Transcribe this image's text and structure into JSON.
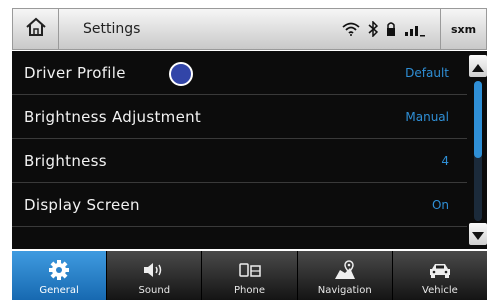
{
  "header": {
    "title": "Settings",
    "home_icon": "home-icon",
    "status_icons": [
      "wifi-icon",
      "bluetooth-icon",
      "lock-icon",
      "signal-icon"
    ],
    "sxm_label": "sxm"
  },
  "settings_list": {
    "rows": [
      {
        "label": "Driver Profile",
        "value": "Default"
      },
      {
        "label": "Brightness Adjustment",
        "value": "Manual"
      },
      {
        "label": "Brightness",
        "value": "4"
      },
      {
        "label": "Display Screen",
        "value": "On"
      }
    ]
  },
  "scrollbar": {
    "up_icon": "triangle-up-icon",
    "down_icon": "triangle-down-icon",
    "position_fraction": 0.0,
    "visible_fraction": 0.55
  },
  "tabs": [
    {
      "label": "General",
      "icon": "gear-icon",
      "active": true
    },
    {
      "label": "Sound",
      "icon": "speaker-icon",
      "active": false
    },
    {
      "label": "Phone",
      "icon": "phone-icon",
      "active": false
    },
    {
      "label": "Navigation",
      "icon": "map-icon",
      "active": false
    },
    {
      "label": "Vehicle",
      "icon": "car-icon",
      "active": false
    }
  ],
  "colors": {
    "accent": "#2f8fd6",
    "active_tab": "#2a82cc",
    "list_background": "#0c0c0c",
    "cursor_dot": "#3245a8"
  }
}
